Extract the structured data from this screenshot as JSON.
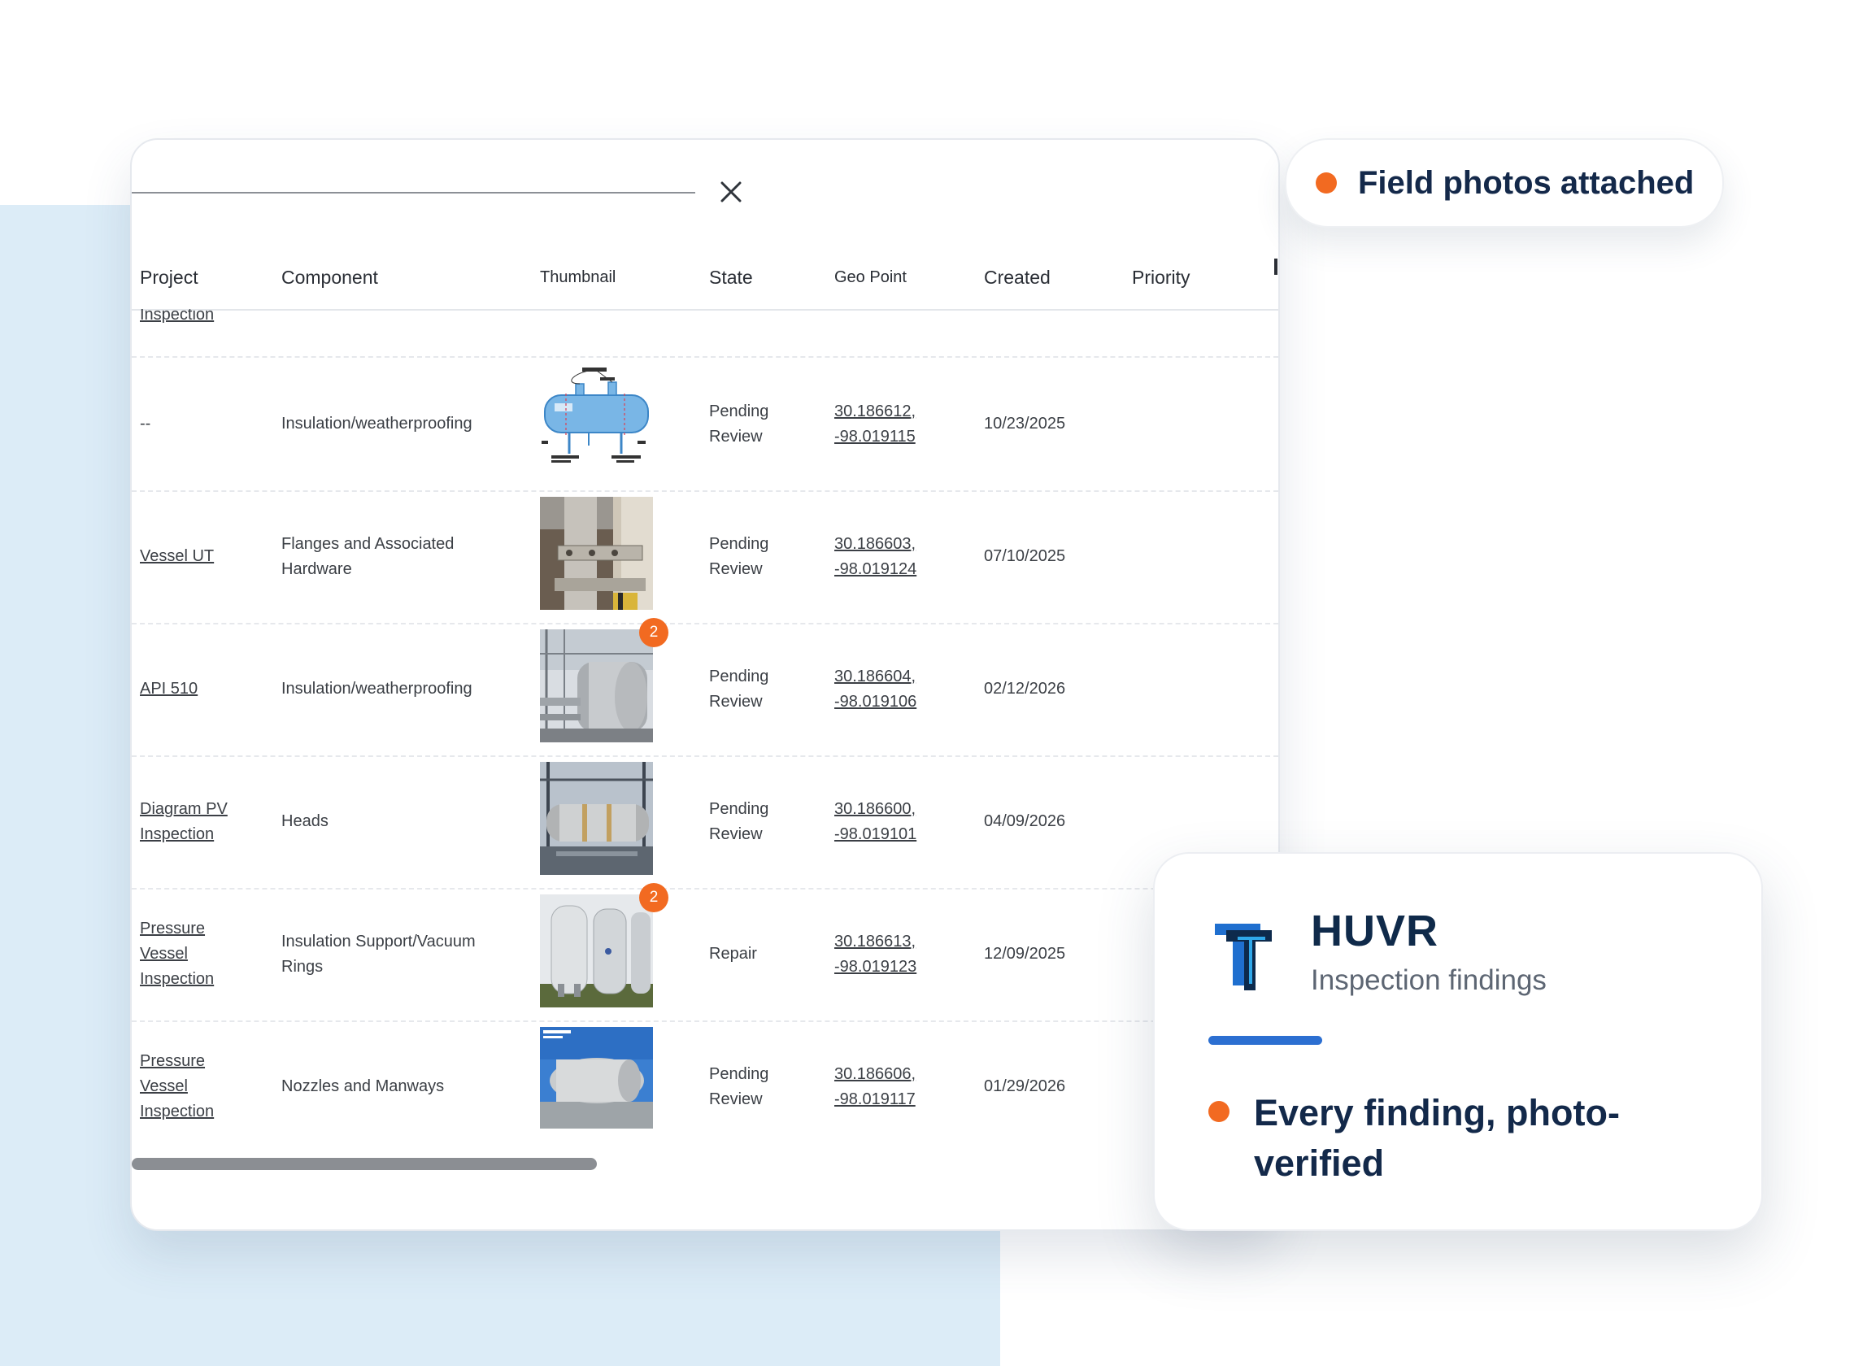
{
  "table": {
    "headers": {
      "project": "Project",
      "component": "Component",
      "thumbnail": "Thumbnail",
      "state": "State",
      "geo_point": "Geo Point",
      "created": "Created",
      "priority": "Priority"
    },
    "partial_row_project": "Inspection",
    "rows": [
      {
        "project": "--",
        "component": "Insulation/weatherproofing",
        "thumbnail": "pressure-vessel-diagram",
        "badge": "",
        "state": "Pending Review",
        "geo_lat": "30.186612,",
        "geo_lon": "-98.019115",
        "created": "10/23/2025",
        "priority": ""
      },
      {
        "project": "Vessel UT",
        "component": "Flanges and Associated Hardware",
        "thumbnail": "flange-photo",
        "badge": "",
        "state": "Pending Review",
        "geo_lat": "30.186603,",
        "geo_lon": "-98.019124",
        "created": "07/10/2025",
        "priority": ""
      },
      {
        "project": "API 510",
        "component": "Insulation/weatherproofing",
        "thumbnail": "vessel-photo",
        "badge": "2",
        "state": "Pending Review",
        "geo_lat": "30.186604,",
        "geo_lon": "-98.019106",
        "created": "02/12/2026",
        "priority": ""
      },
      {
        "project": "Diagram PV Inspection",
        "component": "Heads",
        "thumbnail": "vessel-heads-photo",
        "badge": "",
        "state": "Pending Review",
        "geo_lat": "30.186600,",
        "geo_lon": "-98.019101",
        "created": "04/09/2026",
        "priority": ""
      },
      {
        "project": "Pressure Vessel Inspection",
        "component": "Insulation Support/Vacuum Rings",
        "thumbnail": "vertical-tanks-photo",
        "badge": "2",
        "state": "Repair",
        "geo_lat": "30.186613,",
        "geo_lon": "-98.019123",
        "created": "12/09/2025",
        "priority": ""
      },
      {
        "project": "Pressure Vessel Inspection",
        "component": "Nozzles and Manways",
        "thumbnail": "exchanger-photo",
        "badge": "",
        "state": "Pending Review",
        "geo_lat": "30.186606,",
        "geo_lon": "-98.019117",
        "created": "01/29/2026",
        "priority": ""
      }
    ]
  },
  "pill": {
    "text": "Field photos attached",
    "dot_color": "#f26a21"
  },
  "huvr_card": {
    "title": "HUVR",
    "subtitle": "Inspection findings",
    "bullet": "Every finding, photo-verified",
    "accent_color": "#2c6fd1",
    "dot_color": "#f26a21"
  },
  "icons": {
    "close": "close-icon",
    "logo": "huvr-logo-icon"
  }
}
